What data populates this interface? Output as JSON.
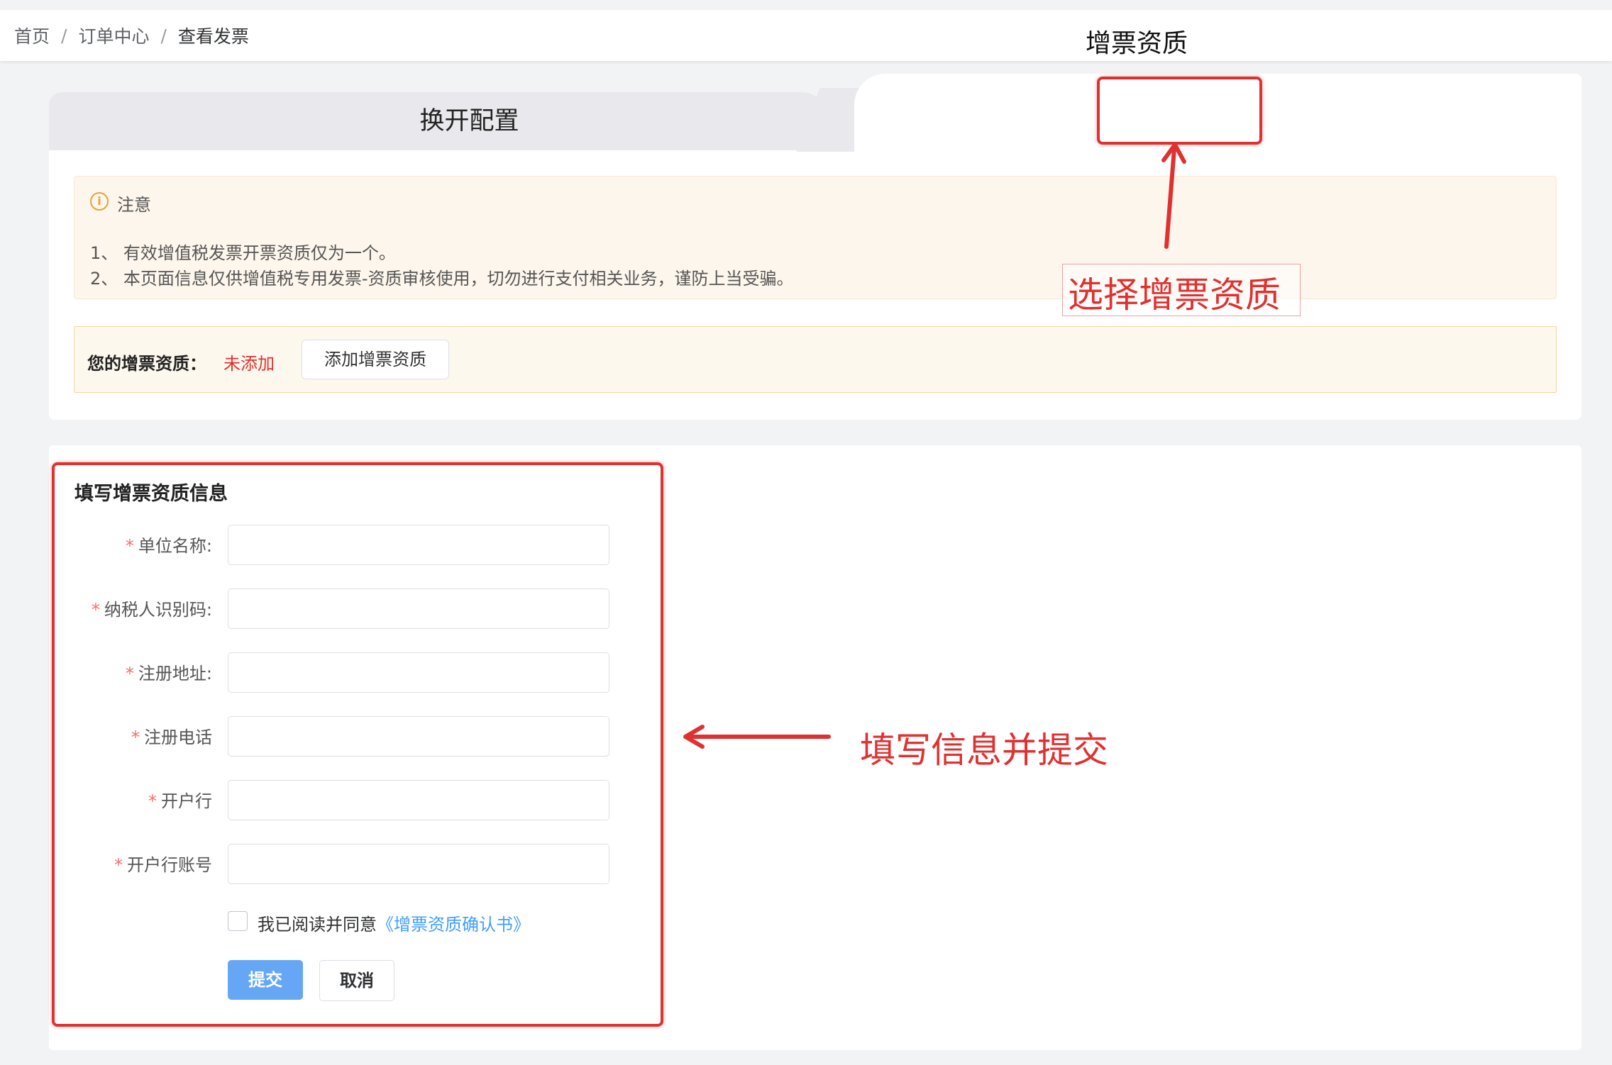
{
  "breadcrumb": {
    "home": "首页",
    "orders": "订单中心",
    "current": "查看发票",
    "separator": "/"
  },
  "tabs": {
    "left": "换开配置",
    "right": "增票资质"
  },
  "notice": {
    "icon": "info-circle-icon",
    "title": "注意",
    "line1": "1、 有效增值税发票开票资质仅为一个。",
    "line2": "2、 本页面信息仅供增值税专用发票-资质审核使用，切勿进行支付相关业务，谨防上当受骗。"
  },
  "qualification": {
    "label": "您的增票资质：",
    "status": "未添加",
    "add_button": "添加增票资质"
  },
  "form": {
    "title": "填写增票资质信息",
    "required_mark": "*",
    "fields": [
      {
        "label": "单位名称:",
        "value": ""
      },
      {
        "label": "纳税人识别码:",
        "value": ""
      },
      {
        "label": "注册地址:",
        "value": ""
      },
      {
        "label": "注册电话",
        "value": ""
      },
      {
        "label": "开户行",
        "value": ""
      },
      {
        "label": "开户行账号",
        "value": ""
      }
    ],
    "agreement_prefix": "我已阅读并同意",
    "agreement_link": "《增票资质确认书》",
    "submit": "提交",
    "cancel": "取消"
  },
  "annotations": {
    "select_qualification": "选择增票资质",
    "fill_and_submit": "填写信息并提交"
  },
  "colors": {
    "annotation_red": "#e03131",
    "primary_blue": "#66a7f5",
    "link_blue": "#409eff",
    "required_red": "#f56c6c",
    "notice_bg": "#fdf6ec"
  }
}
